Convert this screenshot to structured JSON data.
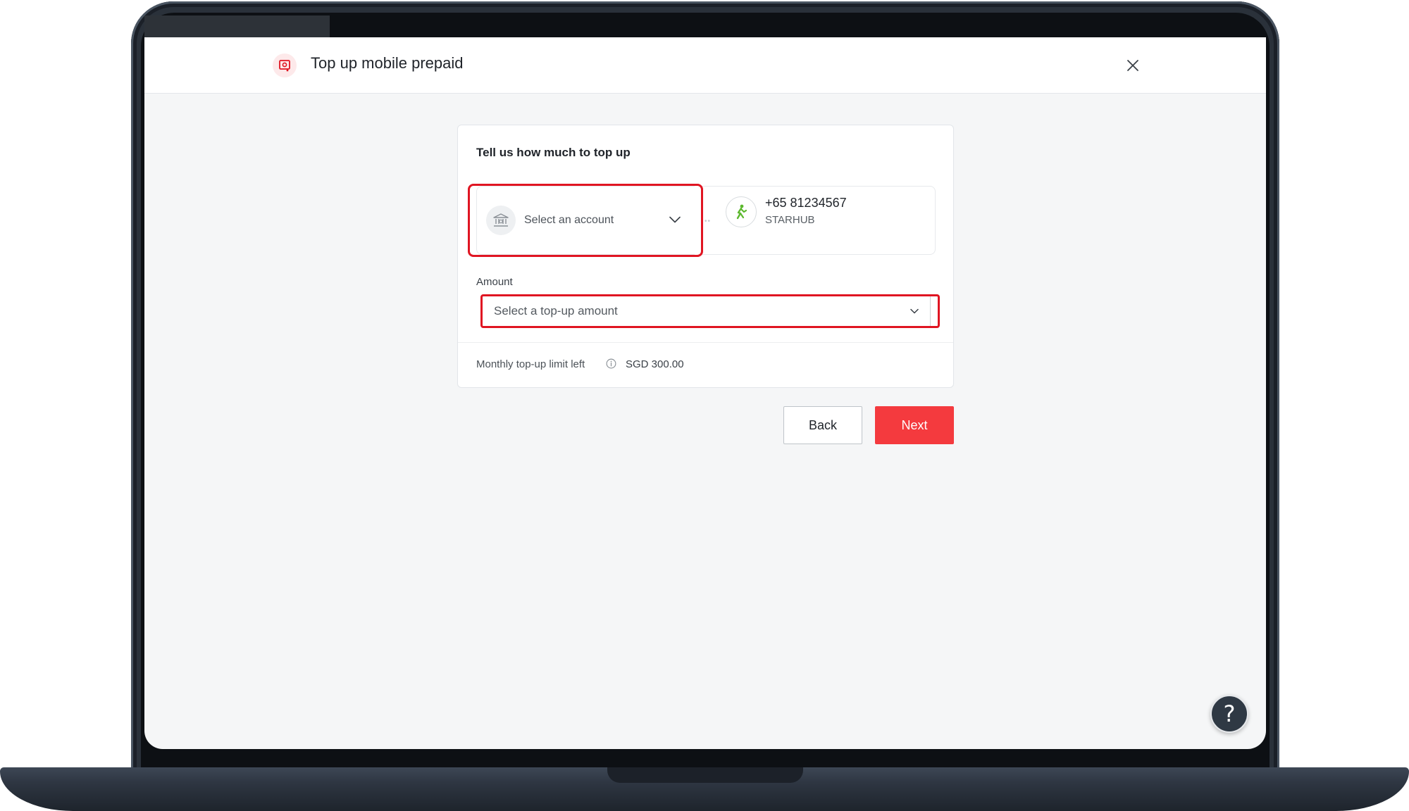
{
  "header": {
    "title": "Top up mobile prepaid",
    "close_label": "×"
  },
  "card": {
    "title": "Tell us how much to top up",
    "from": {
      "placeholder": "Select an account",
      "icon": "bank-icon"
    },
    "to": {
      "phone": "+65 81234567",
      "operator": "STARHUB",
      "icon": "starhub-logo"
    },
    "amount": {
      "label": "Amount",
      "placeholder": "Select a top-up amount"
    },
    "limit": {
      "label": "Monthly top-up limit left",
      "value": "SGD 300.00"
    }
  },
  "actions": {
    "back_label": "Back",
    "next_label": "Next"
  },
  "help": {
    "label": "?"
  },
  "colors": {
    "accent": "#f43a3e",
    "highlight": "#e01522",
    "help_bg": "#2f3944"
  }
}
